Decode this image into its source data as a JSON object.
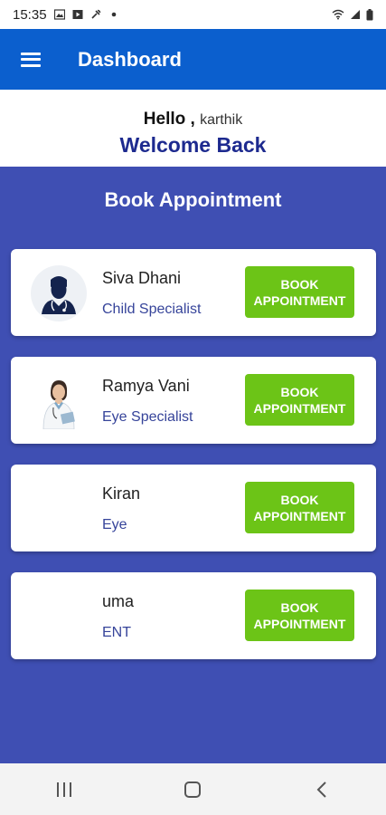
{
  "status_bar": {
    "time": "15:35"
  },
  "appbar": {
    "title": "Dashboard"
  },
  "greeting": {
    "hello": "Hello",
    "separator": ",",
    "username": "karthik",
    "welcome": "Welcome Back"
  },
  "section": {
    "title": "Book Appointment"
  },
  "doctors": [
    {
      "name": "Siva Dhani",
      "specialty": "Child Specialist",
      "avatar": "doctor-silhouette-icon",
      "button_line1": "BOOK",
      "button_line2": "APPOINTMENT"
    },
    {
      "name": "Ramya Vani",
      "specialty": "Eye Specialist",
      "avatar": "doctor-photo",
      "button_line1": "BOOK",
      "button_line2": "APPOINTMENT"
    },
    {
      "name": "Kiran",
      "specialty": "Eye",
      "avatar": "blank-avatar",
      "button_line1": "BOOK",
      "button_line2": "APPOINTMENT"
    },
    {
      "name": "uma",
      "specialty": "ENT",
      "avatar": "blank-avatar",
      "button_line1": "BOOK",
      "button_line2": "APPOINTMENT"
    }
  ],
  "colors": {
    "appbar": "#0b5fce",
    "background": "#3f4fb3",
    "button": "#6cc417",
    "welcome": "#1d2a8f",
    "specialty": "#36449a"
  },
  "nav": {
    "icons": [
      "recent-apps-icon",
      "home-icon",
      "back-icon"
    ]
  }
}
